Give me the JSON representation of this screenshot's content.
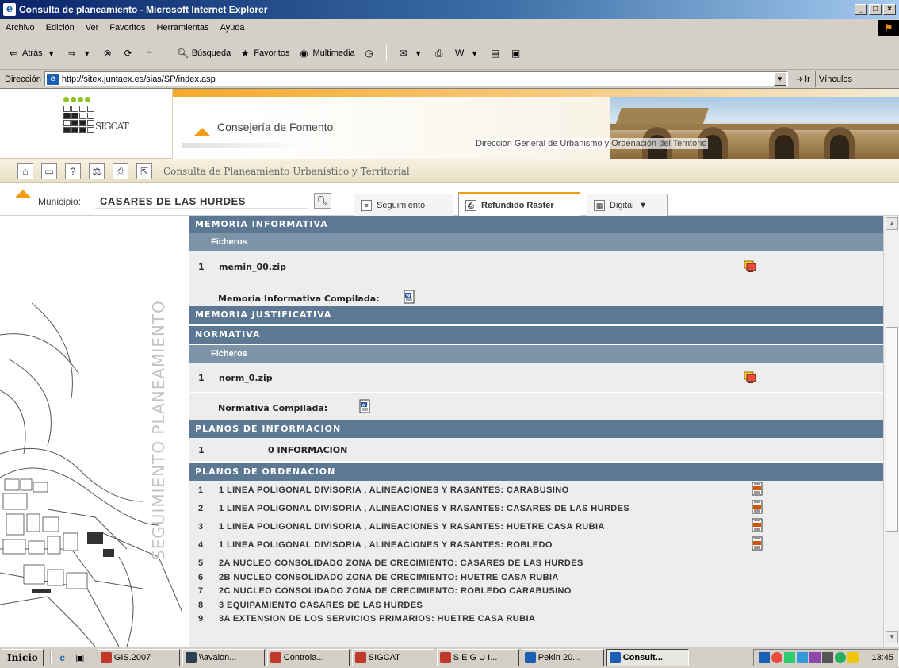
{
  "window": {
    "title": "Consulta de planeamiento - Microsoft Internet Explorer",
    "controls": [
      "_",
      "□",
      "×"
    ]
  },
  "menu": [
    "Archivo",
    "Edición",
    "Ver",
    "Favoritos",
    "Herramientas",
    "Ayuda"
  ],
  "toolbar": {
    "back": "Atrás",
    "search": "Búsqueda",
    "favorites": "Favoritos",
    "media": "Multimedia"
  },
  "address": {
    "label": "Dirección",
    "url": "http://sitex.juntaex.es/sias/SP/index.asp",
    "go": "Ir",
    "links": "Vínculos"
  },
  "site": {
    "logo_text": "SIGCAT",
    "consejeria": "Consejería de Fomento",
    "direccion": "Dirección General de Urbanismo y Ordenación del Territorio",
    "nav_title": "Consulta de Planeamiento Urbanístico y Territorial"
  },
  "municipio": {
    "label": "Municipio:",
    "value": "CASARES DE LAS HURDES"
  },
  "tabs": [
    {
      "label": "Seguimiento",
      "active": false
    },
    {
      "label": "Refundido Raster",
      "active": true
    },
    {
      "label": "Digital",
      "active": false
    }
  ],
  "sidebar": {
    "vertical_label": "SEGUIMIENTO PLANEAMIENTO"
  },
  "sections": {
    "memoria_informativa": "MEMORIA INFORMATIVA",
    "ficheros": "Ficheros",
    "memin_num": "1",
    "memin_file": "memin_00.zip",
    "memin_compilada": "Memoria Informativa Compilada:",
    "memoria_justificativa": "MEMORIA JUSTIFICATIVA",
    "normativa": "NORMATIVA",
    "ficheros2": "Ficheros",
    "norm_num": "1",
    "norm_file": "norm_0.zip",
    "norm_compilada": "Normativa Compilada:",
    "planos_info": "PLANOS DE INFORMACION",
    "planos_info_num": "1",
    "planos_info_item": "0 INFORMACION",
    "planos_ord": "PLANOS DE ORDENACION"
  },
  "planos_ordenacion": [
    {
      "n": "1",
      "t": "1 LINEA POLIGONAL DIVISORIA , ALINEACIONES Y RASANTES: CARABUSINO",
      "jpg": true
    },
    {
      "n": "2",
      "t": "1 LINEA POLIGONAL DIVISORIA , ALINEACIONES Y RASANTES: CASARES DE LAS HURDES",
      "jpg": true
    },
    {
      "n": "3",
      "t": "1 LINEA POLIGONAL DIVISORIA , ALINEACIONES Y RASANTES: HUETRE CASA RUBIA",
      "jpg": true
    },
    {
      "n": "4",
      "t": "1 LINEA POLIGONAL DIVISORIA , ALINEACIONES Y RASANTES: ROBLEDO",
      "jpg": true
    },
    {
      "n": "5",
      "t": "2A NUCLEO CONSOLIDADO ZONA DE CRECIMIENTO: CASARES DE LAS HURDES",
      "jpg": false
    },
    {
      "n": "6",
      "t": "2B NUCLEO CONSOLIDADO ZONA DE CRECIMIENTO: HUETRE CASA RUBIA",
      "jpg": false
    },
    {
      "n": "7",
      "t": "2C NUCLEO CONSOLIDADO ZONA DE CRECIMIENTO: ROBLEDO CARABUSINO",
      "jpg": false
    },
    {
      "n": "8",
      "t": "3 EQUIPAMIENTO CASARES DE LAS HURDES",
      "jpg": false
    },
    {
      "n": "9",
      "t": "3A EXTENSION DE LOS SERVICIOS PRIMARIOS: HUETRE CASA RUBIA",
      "jpg": false
    }
  ],
  "taskbar": {
    "start": "Inicio",
    "tasks": [
      {
        "label": "GIS.2007",
        "color": "#c0392b",
        "active": false
      },
      {
        "label": "\\\\avalon...",
        "color": "#2c3e50",
        "active": false
      },
      {
        "label": "Controla...",
        "color": "#c0392b",
        "active": false
      },
      {
        "label": "SIGCAT",
        "color": "#c0392b",
        "active": false
      },
      {
        "label": "S E G U I...",
        "color": "#c0392b",
        "active": false
      },
      {
        "label": "Pekín 20...",
        "color": "#1a5fb4",
        "active": false
      },
      {
        "label": "Consult...",
        "color": "#1a5fb4",
        "active": true
      }
    ],
    "clock": "13:45"
  },
  "colors": {
    "section_bar": "#5c7893",
    "subsection_bar": "#7d93a8",
    "accent_orange": "#f39c12"
  }
}
